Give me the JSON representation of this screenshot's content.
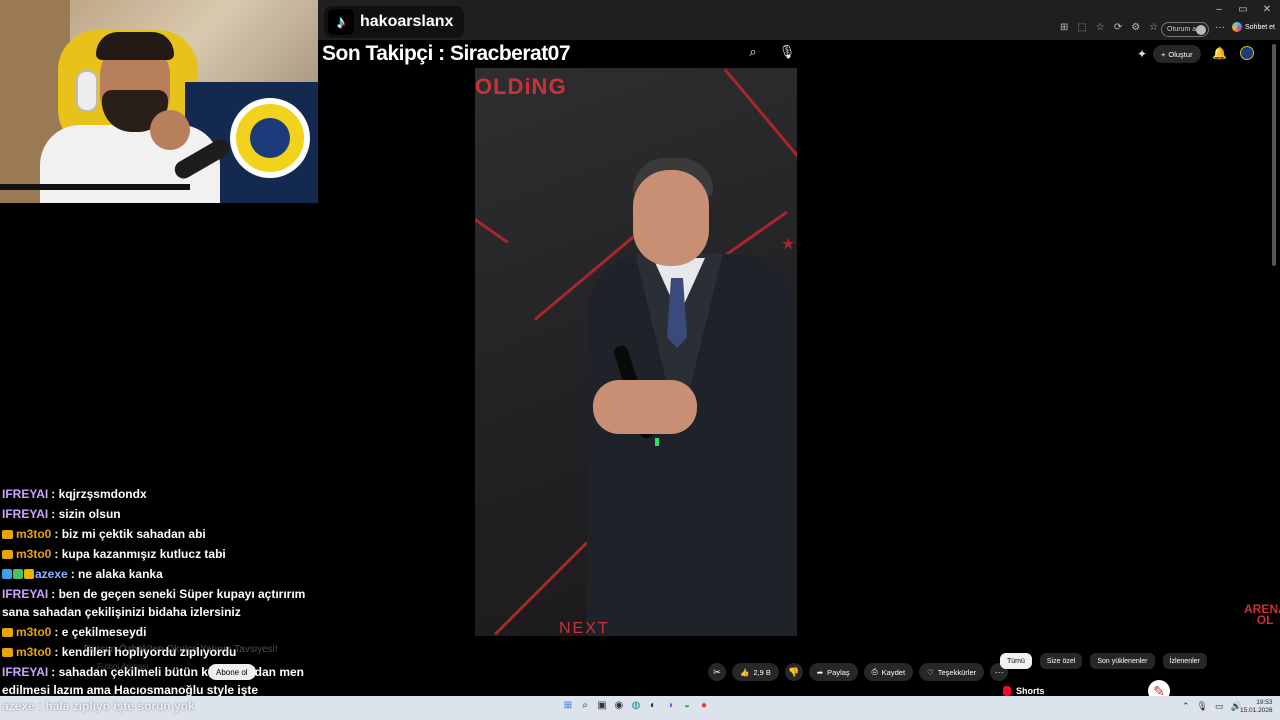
{
  "tiktok": {
    "username": "hakoarslanx",
    "logo_glyph": "♪"
  },
  "follower_overlay": "Son Takipçi : Siracberat07",
  "browser": {
    "window_controls": [
      "–",
      "▭",
      "✕"
    ],
    "toolbar_icons": [
      "⊞",
      "⬚",
      "☆",
      "⟳",
      "⚙",
      "☆"
    ],
    "signin_text": "Oturum aç",
    "more_dots": "···",
    "chat_button": "Sohbet et"
  },
  "youtube": {
    "search_icon": "⌕",
    "mic_icon": "🎙",
    "create_label": "Oluştur",
    "create_plus": "+",
    "bell_icon": "🔔",
    "spark_icon": "✦",
    "video": {
      "brand_text": "OLDiNG",
      "bottom_text": "NEXT"
    },
    "ghost_title": "Dursun Özbek'ten Okulca Yatırım Tavsiyesi!",
    "ghost_channel": "Futbol Arenası",
    "ghost_sub": "Abone ol",
    "actions": {
      "likes": "2,9 B",
      "share": "Paylaş",
      "save": "Kaydet",
      "thanks": "Teşekkürler",
      "more": "···"
    },
    "side_brand": "ARENA OL",
    "chips": [
      "Tümü",
      "Size özel",
      "Son yüklenenler",
      "İzlenenler"
    ],
    "shorts_label": "Shorts"
  },
  "chat": [
    {
      "user": "IFREYAI",
      "user_color": "#c9a6ff",
      "badges": [],
      "text": "kqjrzşsmdondx"
    },
    {
      "user": "IFREYAI",
      "user_color": "#c9a6ff",
      "badges": [],
      "text": "sizin olsun"
    },
    {
      "user": "m3to0",
      "user_color": "#e8a400",
      "badges": [
        "crown"
      ],
      "text": "biz mi çektik sahadan abi"
    },
    {
      "user": "m3to0",
      "user_color": "#e8a400",
      "badges": [
        "crown"
      ],
      "text": "kupa kazanmışız kutlucz tabi"
    },
    {
      "user": "azexe",
      "user_color": "#8ab4ff",
      "badges": [
        "blue",
        "green",
        "gold"
      ],
      "text": "ne alaka kanka"
    },
    {
      "user": "IFREYAI",
      "user_color": "#c9a6ff",
      "badges": [],
      "text": "ben de geçen seneki Süper kupayı açtırırım sana sahadan çekilişinizi bidaha izlersiniz",
      "wrap": true
    },
    {
      "user": "m3to0",
      "user_color": "#e8a400",
      "badges": [
        "crown"
      ],
      "text": "e çekilmeseydi"
    },
    {
      "user": "m3to0",
      "user_color": "#e8a400",
      "badges": [
        "crown"
      ],
      "text": "kendileri hoplıyordu zıplıyordu"
    },
    {
      "user": "IFREYAI",
      "user_color": "#c9a6ff",
      "badges": [],
      "text": "sahadan çekilmeli bütün kupalarından men edilmesi lazım ama Hacıosmanoğlu style işte",
      "wrap": true
    }
  ],
  "last_chat": {
    "user": "azexe",
    "text": "hala zıplıyo işte sorun yok"
  },
  "taskbar": {
    "apps": [
      "⊞",
      "⌕",
      "▣",
      "◉",
      "◍",
      "◐",
      "◑",
      "◒",
      "●"
    ],
    "tray": [
      "⌃",
      "🎙",
      "▭",
      "🔊"
    ],
    "time": "19:53",
    "date": "15.01.2026"
  },
  "colors": {
    "accent_red": "#c8323b",
    "bg": "#000000",
    "crown": "#e8a400"
  }
}
